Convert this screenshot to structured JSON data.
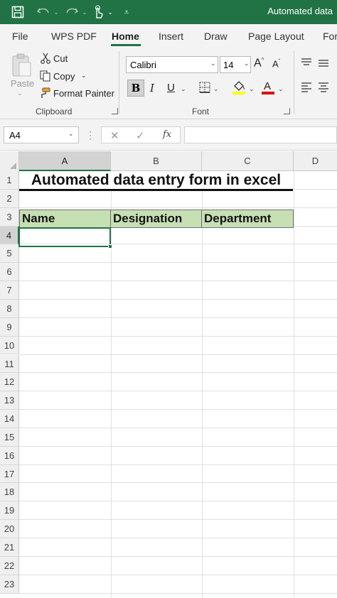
{
  "titlebar": {
    "title": "Automated data",
    "color": "#217346",
    "icons": [
      "save-icon",
      "undo-icon",
      "redo-icon",
      "touch-mode-icon",
      "customize-toolbar-icon"
    ]
  },
  "tabs": [
    "File",
    "WPS PDF",
    "Home",
    "Insert",
    "Draw",
    "Page Layout",
    "For"
  ],
  "active_tab": "Home",
  "clipboard": {
    "paste": "Paste",
    "cut": "Cut",
    "copy": "Copy",
    "format_painter": "Format Painter",
    "group_label": "Clipboard"
  },
  "font": {
    "family": "Calibri",
    "size": "14",
    "bold": "B",
    "italic": "I",
    "underline": "U",
    "group_label": "Font",
    "fill_color": "#ffff00",
    "font_color": "#e00000"
  },
  "formula_bar": {
    "name_box": "A4",
    "fx": "fx",
    "value": ""
  },
  "grid": {
    "columns": [
      "A",
      "B",
      "C",
      "D"
    ],
    "selected_column": "A",
    "rows": [
      "1",
      "2",
      "3",
      "4",
      "5",
      "6",
      "7",
      "8",
      "9",
      "10",
      "11",
      "12",
      "13",
      "14",
      "15",
      "16",
      "17",
      "18",
      "19",
      "20",
      "21",
      "22",
      "23"
    ],
    "selected_row": "4",
    "title_cell": "Automated data entry form in excel",
    "headers": [
      "Name",
      "Designation",
      "Department"
    ],
    "header_fill": "#c6e0b4",
    "active_cell": "A4"
  }
}
